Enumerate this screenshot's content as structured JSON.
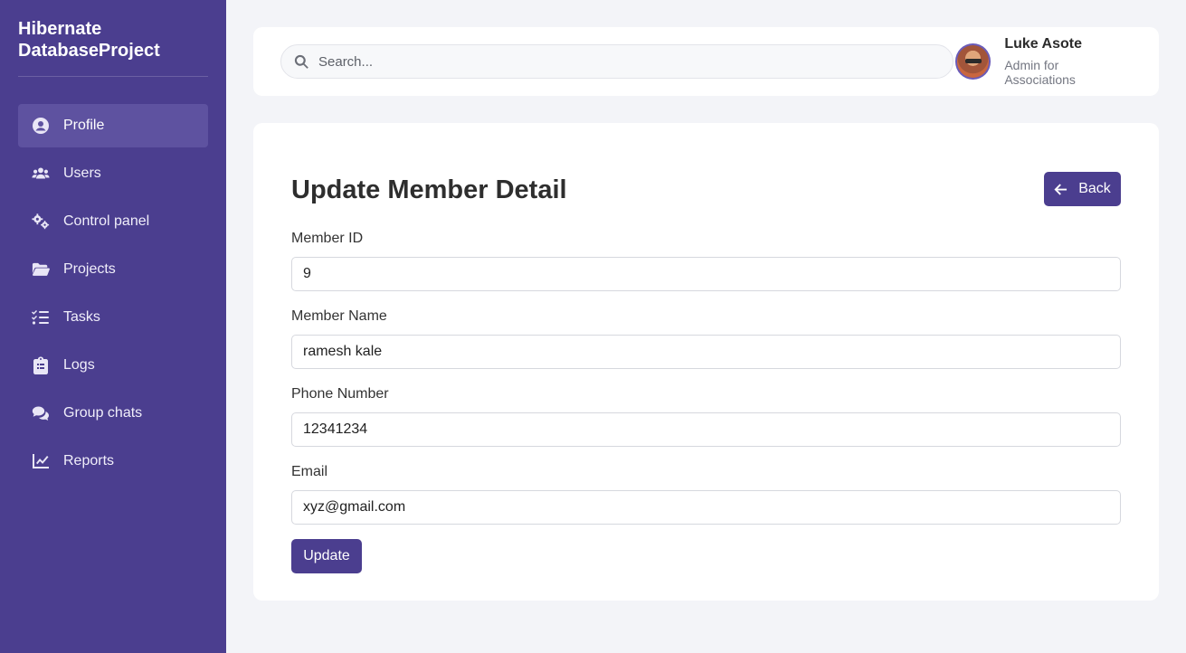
{
  "brand": {
    "title": "Hibernate DatabaseProject"
  },
  "sidebar": {
    "items": [
      {
        "label": "Profile",
        "icon": "user-circle-icon",
        "active": true
      },
      {
        "label": "Users",
        "icon": "users-icon"
      },
      {
        "label": "Control panel",
        "icon": "gears-icon"
      },
      {
        "label": "Projects",
        "icon": "folder-open-icon"
      },
      {
        "label": "Tasks",
        "icon": "list-check-icon"
      },
      {
        "label": "Logs",
        "icon": "clipboard-icon"
      },
      {
        "label": "Group chats",
        "icon": "comments-icon"
      },
      {
        "label": "Reports",
        "icon": "chart-line-icon"
      }
    ]
  },
  "header": {
    "search": {
      "placeholder": "Search...",
      "value": ""
    },
    "user": {
      "name": "Luke Asote",
      "role": "Admin for Associations"
    }
  },
  "main": {
    "title": "Update Member Detail",
    "back_label": "Back",
    "fields": {
      "member_id": {
        "label": "Member ID",
        "value": "9"
      },
      "member_name": {
        "label": "Member Name",
        "value": "ramesh kale"
      },
      "phone": {
        "label": "Phone Number",
        "value": "12341234"
      },
      "email": {
        "label": "Email",
        "value": "xyz@gmail.com"
      }
    },
    "submit_label": "Update"
  },
  "colors": {
    "accent": "#4b3e8f",
    "sidebar_active": "#5e52a0",
    "background": "#f3f4f8"
  }
}
